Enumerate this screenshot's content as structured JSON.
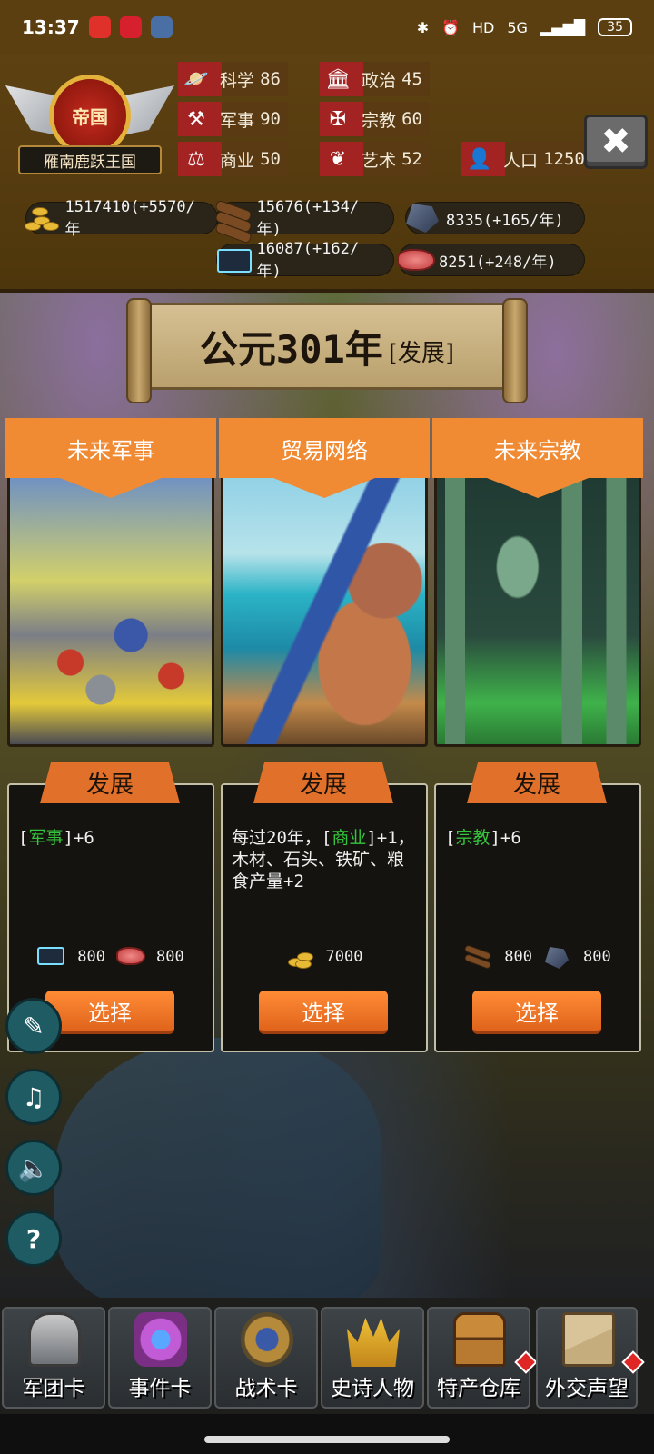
{
  "status_bar": {
    "time": "13:37",
    "network": "5G",
    "battery": "35",
    "hd_label": "HD"
  },
  "kingdom": {
    "emblem_text": "帝国",
    "name": "雁南鹿跃王国"
  },
  "stats": [
    {
      "icon": "planet-icon",
      "label": "科学",
      "value": "86"
    },
    {
      "icon": "temple-icon",
      "label": "政治",
      "value": "45"
    },
    {
      "icon": "crossed-tools-icon",
      "label": "军事",
      "value": "90"
    },
    {
      "icon": "religion-icon",
      "label": "宗教",
      "value": "60"
    },
    {
      "icon": "scales-icon",
      "label": "商业",
      "value": "50"
    },
    {
      "icon": "art-icon",
      "label": "艺术",
      "value": "52"
    },
    {
      "icon": "person-icon",
      "label": "人口",
      "value": "1250"
    }
  ],
  "resources": [
    {
      "icon": "gold-coins-icon",
      "text": "1517410(+5570/年"
    },
    {
      "icon": "wood-logs-icon",
      "text": "15676(+134/年)"
    },
    {
      "icon": "stone-ore-icon",
      "text": "8335(+165/年)"
    },
    {
      "icon": "iron-chest-icon",
      "text": "16087(+162/年)"
    },
    {
      "icon": "meat-food-icon",
      "text": "8251(+248/年)"
    }
  ],
  "era": {
    "year": "公元301年",
    "phase": "[发展]"
  },
  "cards": [
    {
      "title": "未来军事",
      "tag": "发展",
      "desc_prefix": "[",
      "desc_highlight": "军事",
      "desc_suffix": "]+6",
      "costs": [
        {
          "icon": "iron-chest-icon",
          "value": "800"
        },
        {
          "icon": "meat-food-icon",
          "value": "800"
        }
      ],
      "button": "选择"
    },
    {
      "title": "贸易网络",
      "tag": "发展",
      "desc_prefix": "每过20年，[",
      "desc_highlight": "商业",
      "desc_suffix": "]+1，木材、石头、铁矿、粮食产量+2",
      "costs": [
        {
          "icon": "gold-coins-icon",
          "value": "7000"
        }
      ],
      "button": "选择"
    },
    {
      "title": "未来宗教",
      "tag": "发展",
      "desc_prefix": "[",
      "desc_highlight": "宗教",
      "desc_suffix": "]+6",
      "costs": [
        {
          "icon": "wood-logs-icon",
          "value": "800"
        },
        {
          "icon": "stone-ore-icon",
          "value": "800"
        }
      ],
      "button": "选择"
    }
  ],
  "side_buttons": [
    {
      "icon": "book-quill-icon"
    },
    {
      "icon": "music-off-icon"
    },
    {
      "icon": "speaker-icon"
    },
    {
      "icon": "help-icon",
      "glyph": "?"
    }
  ],
  "bottom_nav": [
    {
      "icon": "knight-helmet-icon",
      "label": "军团卡"
    },
    {
      "icon": "magic-scroll-icon",
      "label": "事件卡"
    },
    {
      "icon": "shield-swords-icon",
      "label": "战术卡"
    },
    {
      "icon": "crown-icon",
      "label": "史诗人物"
    },
    {
      "icon": "treasure-chest-icon",
      "label": "特产仓库"
    },
    {
      "icon": "envelope-icon",
      "label": "外交声望"
    }
  ],
  "colors": {
    "header_brown": "#5d4112",
    "card_orange": "#f08a33",
    "highlight_green": "#35c43b",
    "stat_red": "#a32222"
  }
}
